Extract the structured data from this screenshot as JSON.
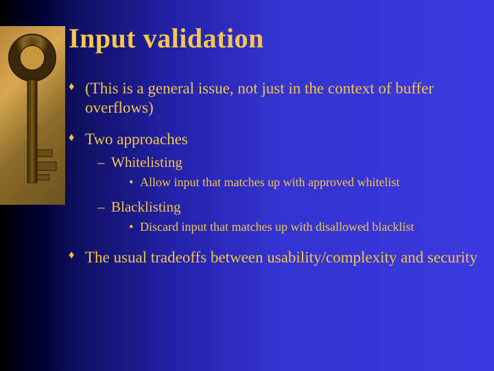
{
  "title": "Input validation",
  "bullets": {
    "item0": "(This is a general issue, not just in the context of buffer overflows)",
    "item1": "Two approaches",
    "item1_sub0": "Whitelisting",
    "item1_sub0_detail": "Allow input that matches up with approved whitelist",
    "item1_sub1": "Blacklisting",
    "item1_sub1_detail": "Discard input that matches up with disallowed blacklist",
    "item2": "The usual tradeoffs between usability/complexity and security"
  }
}
